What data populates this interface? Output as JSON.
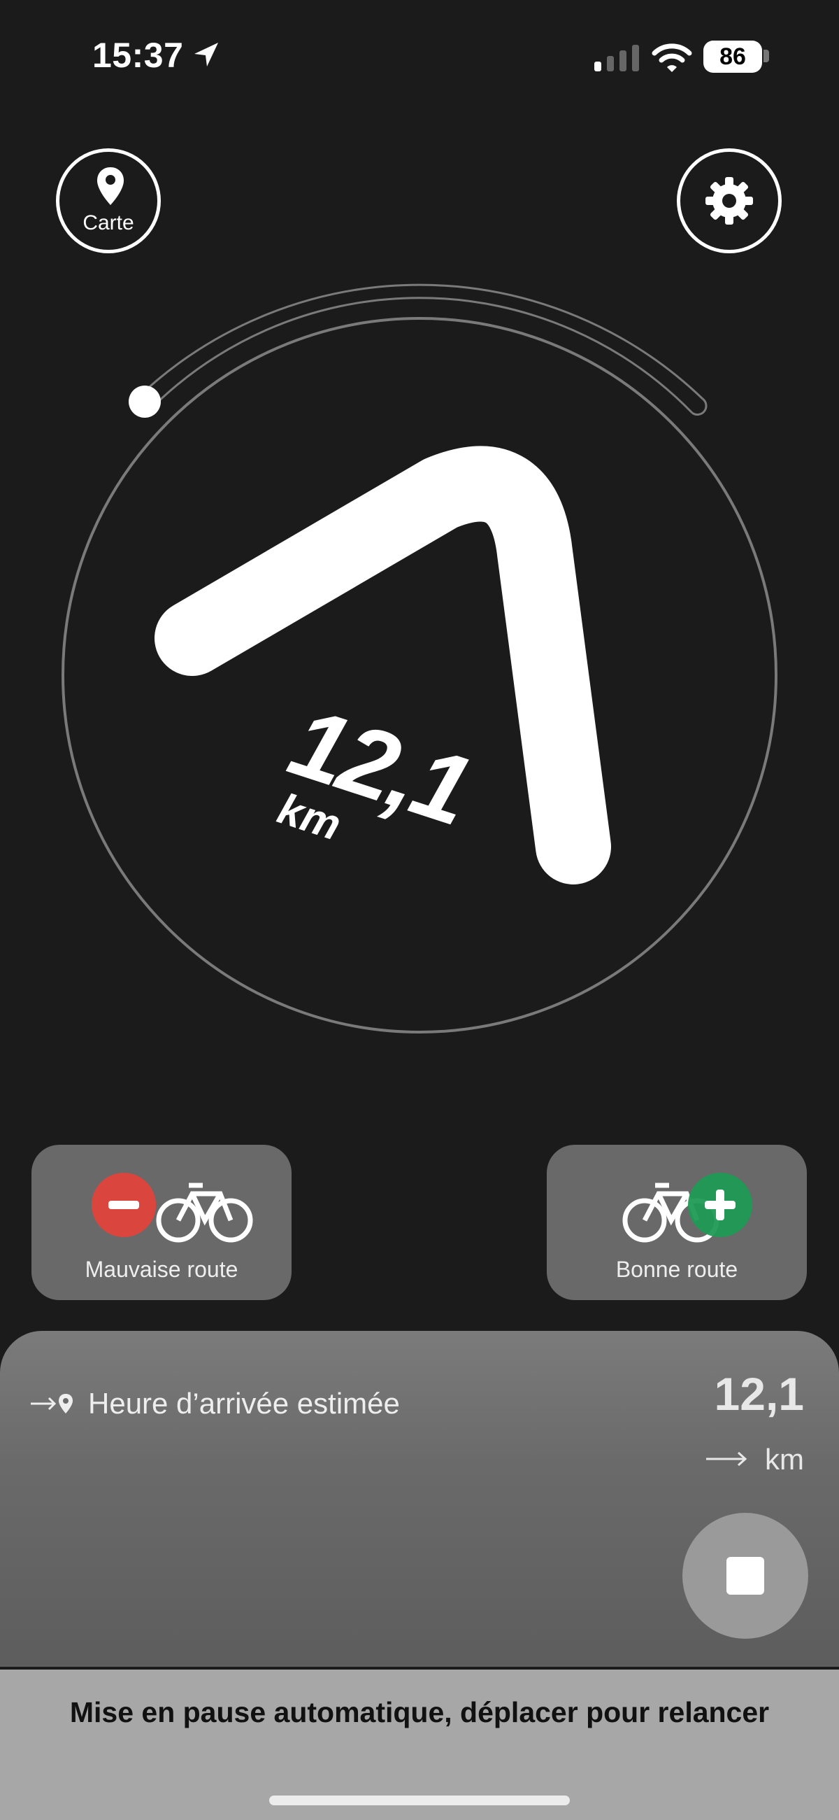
{
  "status_bar": {
    "time": "15:37",
    "battery": "86",
    "icons": [
      "location-arrow-icon",
      "signal-icon",
      "wifi-icon",
      "battery-icon"
    ]
  },
  "top_controls": {
    "map_label": "Carte",
    "map_icon": "map-pin-icon",
    "settings_icon": "gear-icon"
  },
  "navigation": {
    "distance_value": "12,1",
    "distance_unit": "km",
    "turn_icon": "sharp-turn-arrow-icon"
  },
  "route_feedback": {
    "bad_label": "Mauvaise route",
    "good_label": "Bonne route",
    "bad_color": "#e0453c",
    "good_color": "#1f9a55"
  },
  "bottom_panel": {
    "eta_label": "Heure d’arrivée estimée",
    "distance_value": "12,1",
    "distance_unit": "km",
    "stop_icon": "stop-icon"
  },
  "pause_banner": {
    "text": "Mise en pause automatique, déplacer pour relancer"
  }
}
